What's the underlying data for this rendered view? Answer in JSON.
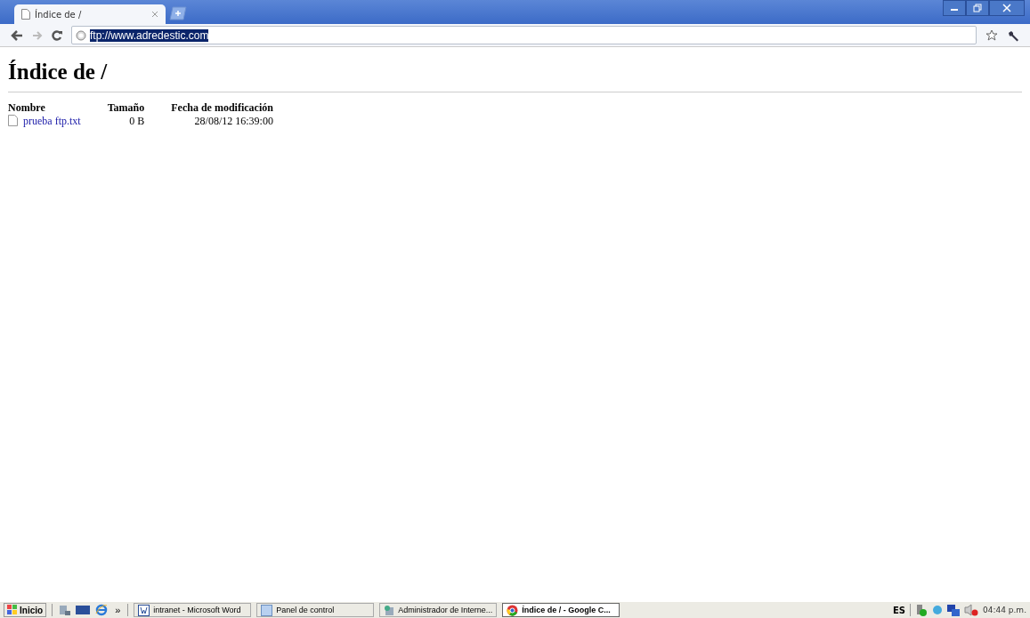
{
  "browser": {
    "tabs": [
      {
        "title": "Índice de /",
        "selected": true
      }
    ],
    "address": "ftp://www.adredestic.com"
  },
  "page": {
    "heading": "Índice de /",
    "columns": [
      "Nombre",
      "Tamaño",
      "Fecha de modificación"
    ],
    "rows": [
      {
        "name": "prueba ftp.txt",
        "size": "0 B",
        "modified": "28/08/12 16:39:00"
      }
    ]
  },
  "taskbar": {
    "start": "Inicio",
    "more": "»",
    "tasks": [
      {
        "label": "intranet - Microsoft Word",
        "kind": "word",
        "selected": false
      },
      {
        "label": "Panel de control",
        "kind": "panel",
        "selected": false
      },
      {
        "label": "Administrador de Interne...",
        "kind": "admin",
        "selected": false
      },
      {
        "label": "Índice de / - Google C...",
        "kind": "chrome",
        "selected": true
      }
    ],
    "language": "ES",
    "clock": "04:44 p.m."
  }
}
